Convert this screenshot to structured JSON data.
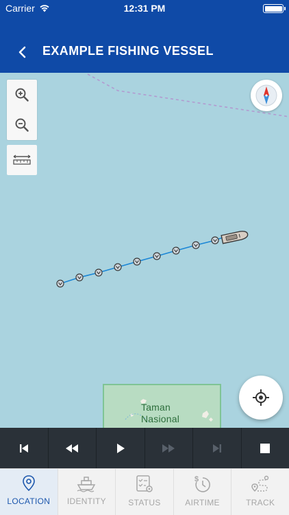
{
  "status_bar": {
    "carrier": "Carrier",
    "time": "12:31 PM"
  },
  "header": {
    "title": "EXAMPLE FISHING VESSEL",
    "background": "#0f4aa7"
  },
  "map": {
    "background": "#aad3df",
    "label_line1": "Taman",
    "label_line2": "Nasional",
    "track_color": "#1a86d6"
  },
  "playback": {
    "buttons": [
      "skip-to-start",
      "rewind",
      "play",
      "fast-forward",
      "skip-to-end",
      "stop"
    ]
  },
  "tabs": [
    {
      "label": "LOCATION",
      "icon": "location-pin-icon",
      "active": true
    },
    {
      "label": "IDENTITY",
      "icon": "ship-icon",
      "active": false
    },
    {
      "label": "STATUS",
      "icon": "checklist-gear-icon",
      "active": false
    },
    {
      "label": "AIRTIME",
      "icon": "dollar-timer-icon",
      "active": false
    },
    {
      "label": "TRACK",
      "icon": "route-icon",
      "active": false
    }
  ]
}
